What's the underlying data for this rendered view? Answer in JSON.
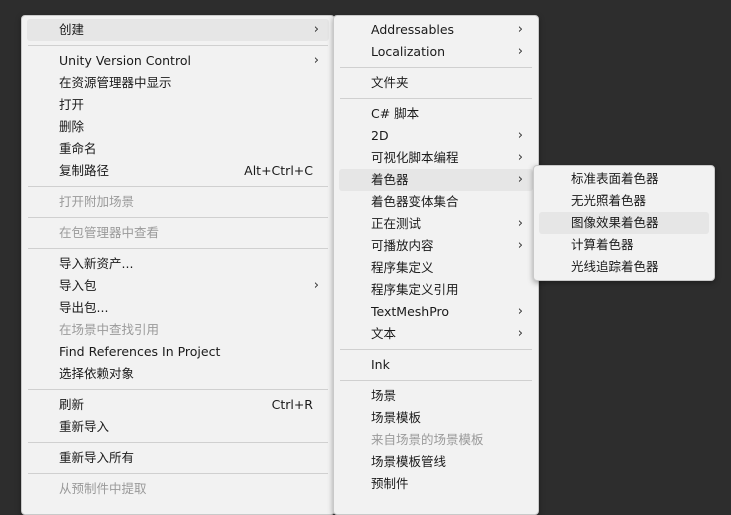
{
  "menu1": {
    "items": [
      {
        "label": "创建",
        "submenu": true,
        "highlighted": true
      },
      {
        "label": "Unity Version Control",
        "submenu": true
      },
      {
        "label": "在资源管理器中显示"
      },
      {
        "label": "打开"
      },
      {
        "label": "删除"
      },
      {
        "label": "重命名"
      },
      {
        "label": "复制路径",
        "shortcut": "Alt+Ctrl+C"
      },
      {
        "label": "打开附加场景",
        "disabled": true
      },
      {
        "label": "在包管理器中查看",
        "disabled": true
      },
      {
        "label": "导入新资产..."
      },
      {
        "label": "导入包",
        "submenu": true
      },
      {
        "label": "导出包..."
      },
      {
        "label": "在场景中查找引用",
        "disabled": true
      },
      {
        "label": "Find References In Project"
      },
      {
        "label": "选择依赖对象"
      },
      {
        "label": "刷新",
        "shortcut": "Ctrl+R"
      },
      {
        "label": "重新导入"
      },
      {
        "label": "重新导入所有"
      },
      {
        "label": "从预制件中提取",
        "disabled": true
      }
    ]
  },
  "menu2": {
    "items": [
      {
        "label": "Addressables",
        "submenu": true
      },
      {
        "label": "Localization",
        "submenu": true
      },
      {
        "label": "文件夹"
      },
      {
        "label": "C# 脚本"
      },
      {
        "label": "2D",
        "submenu": true
      },
      {
        "label": "可视化脚本编程",
        "submenu": true
      },
      {
        "label": "着色器",
        "submenu": true,
        "highlighted": true
      },
      {
        "label": "着色器变体集合"
      },
      {
        "label": "正在测试",
        "submenu": true
      },
      {
        "label": "可播放内容",
        "submenu": true
      },
      {
        "label": "程序集定义"
      },
      {
        "label": "程序集定义引用"
      },
      {
        "label": "TextMeshPro",
        "submenu": true
      },
      {
        "label": "文本",
        "submenu": true
      },
      {
        "label": "Ink"
      },
      {
        "label": "场景"
      },
      {
        "label": "场景模板"
      },
      {
        "label": "来自场景的场景模板",
        "disabled": true
      },
      {
        "label": "场景模板管线"
      },
      {
        "label": "预制件"
      }
    ]
  },
  "menu3": {
    "items": [
      {
        "label": "标准表面着色器"
      },
      {
        "label": "无光照着色器"
      },
      {
        "label": "图像效果着色器",
        "highlighted": true
      },
      {
        "label": "计算着色器"
      },
      {
        "label": "光线追踪着色器"
      }
    ]
  },
  "icons": {
    "submenu_arrow": "chevron-right-icon",
    "glyph": "›"
  }
}
